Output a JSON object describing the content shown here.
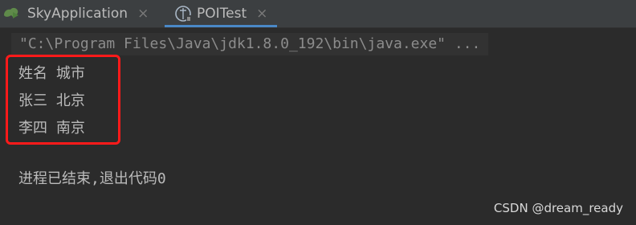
{
  "tabs": [
    {
      "label": "SkyApplication",
      "close": "×",
      "icon": "run-config-icon"
    },
    {
      "label": "POITest",
      "close": "×",
      "icon": "java-file-icon",
      "active": true
    }
  ],
  "console": {
    "command": "\"C:\\Program Files\\Java\\jdk1.8.0_192\\bin\\java.exe\" ...",
    "rows": [
      [
        "姓名",
        "城市"
      ],
      [
        "张三",
        "北京"
      ],
      [
        "李四",
        "南京"
      ]
    ],
    "exit_message": "进程已结束,退出代码0"
  },
  "annotation": {
    "color": "#ff1a1a"
  },
  "watermark": "CSDN @dream_ready",
  "colors": {
    "background": "#2b2b2b",
    "tabbar": "#3c3f41",
    "active_tab_underline": "#4a88c7",
    "text": "#bbbbbb",
    "command_text": "#8c8c8c"
  }
}
